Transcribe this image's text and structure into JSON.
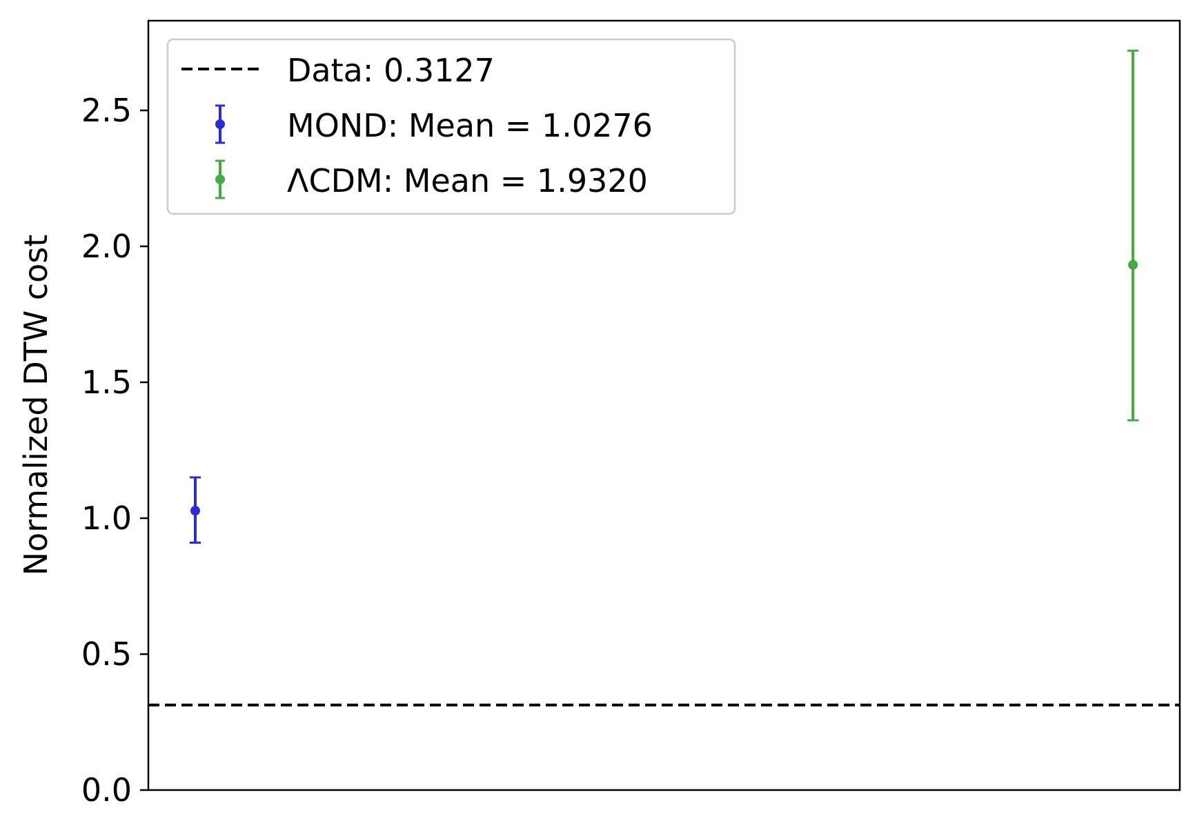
{
  "chart_data": {
    "type": "scatter",
    "title": "",
    "xlabel": "",
    "ylabel": "Normalized DTW cost",
    "ylim": [
      0,
      2.83
    ],
    "xlim": [
      -0.05,
      1.05
    ],
    "yticks": [
      0.0,
      0.5,
      1.0,
      1.5,
      2.0,
      2.5
    ],
    "ytick_labels": [
      "0.0",
      "0.5",
      "1.0",
      "1.5",
      "2.0",
      "2.5"
    ],
    "grid": false,
    "legend_position": "upper-left",
    "reference_line": {
      "label": "Data: 0.3127",
      "y": 0.3127,
      "style": "dashed",
      "color": "#000000"
    },
    "series": [
      {
        "name": "MOND: Mean = 1.0276",
        "x": 0,
        "y": 1.0276,
        "yerr_low": 0.91,
        "yerr_high": 1.15,
        "color": "#2b2bd4"
      },
      {
        "name": "ΛCDM: Mean = 1.9320",
        "x": 1,
        "y": 1.932,
        "yerr_low": 1.36,
        "yerr_high": 2.72,
        "color": "#44aa44"
      }
    ]
  }
}
